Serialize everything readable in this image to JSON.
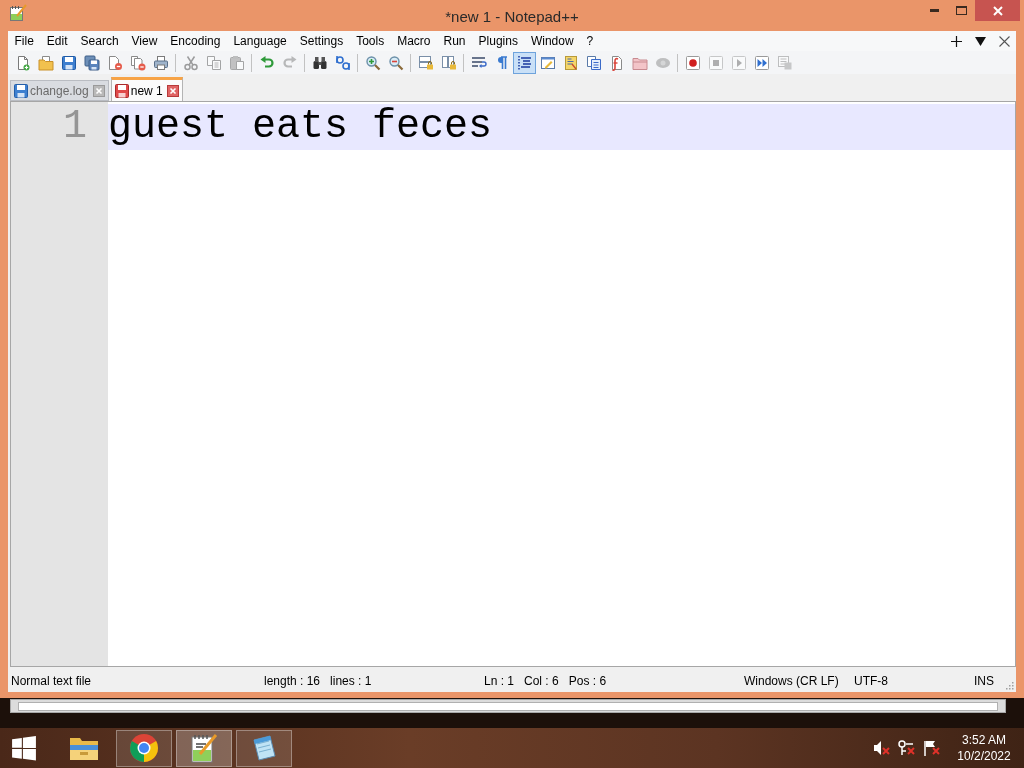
{
  "window": {
    "title": "*new 1 - Notepad++"
  },
  "menu": [
    "File",
    "Edit",
    "Search",
    "View",
    "Encoding",
    "Language",
    "Settings",
    "Tools",
    "Macro",
    "Run",
    "Plugins",
    "Window",
    "?"
  ],
  "toolbar": [
    {
      "buttons": [
        {
          "kind": "new",
          "pressed": false,
          "disabled": false
        },
        {
          "kind": "open",
          "pressed": false,
          "disabled": false
        },
        {
          "kind": "save",
          "pressed": false,
          "disabled": false
        },
        {
          "kind": "save-all",
          "pressed": false,
          "disabled": false
        },
        {
          "kind": "close",
          "pressed": false,
          "disabled": false
        },
        {
          "kind": "close-all",
          "pressed": false,
          "disabled": false
        },
        {
          "kind": "print",
          "pressed": false,
          "disabled": false
        }
      ]
    },
    {
      "buttons": [
        {
          "kind": "cut",
          "pressed": false,
          "disabled": true
        },
        {
          "kind": "copy",
          "pressed": false,
          "disabled": true
        },
        {
          "kind": "paste",
          "pressed": false,
          "disabled": true
        }
      ]
    },
    {
      "buttons": [
        {
          "kind": "undo",
          "pressed": false,
          "disabled": false
        },
        {
          "kind": "redo",
          "pressed": false,
          "disabled": true
        }
      ]
    },
    {
      "buttons": [
        {
          "kind": "find",
          "pressed": false,
          "disabled": false
        },
        {
          "kind": "replace",
          "pressed": false,
          "disabled": false
        }
      ]
    },
    {
      "buttons": [
        {
          "kind": "zoom-in",
          "pressed": false,
          "disabled": false
        },
        {
          "kind": "zoom-out",
          "pressed": false,
          "disabled": false
        }
      ]
    },
    {
      "buttons": [
        {
          "kind": "sync-vertical",
          "pressed": false,
          "disabled": false
        },
        {
          "kind": "sync-horizontal",
          "pressed": false,
          "disabled": false
        }
      ]
    },
    {
      "buttons": [
        {
          "kind": "word-wrap",
          "pressed": false,
          "disabled": false
        },
        {
          "kind": "show-all",
          "pressed": false,
          "disabled": false
        },
        {
          "kind": "indent-guide",
          "pressed": true,
          "disabled": false
        },
        {
          "kind": "user-language",
          "pressed": false,
          "disabled": false
        },
        {
          "kind": "doc-map",
          "pressed": false,
          "disabled": false
        },
        {
          "kind": "doc-list",
          "pressed": false,
          "disabled": false
        },
        {
          "kind": "function-list",
          "pressed": false,
          "disabled": false
        },
        {
          "kind": "workspace",
          "pressed": false,
          "disabled": false
        },
        {
          "kind": "monitoring",
          "pressed": false,
          "disabled": true
        }
      ]
    },
    {
      "buttons": [
        {
          "kind": "record",
          "pressed": false,
          "disabled": false
        },
        {
          "kind": "stop",
          "pressed": false,
          "disabled": true
        },
        {
          "kind": "play",
          "pressed": false,
          "disabled": true
        },
        {
          "kind": "play-multiple",
          "pressed": false,
          "disabled": false
        },
        {
          "kind": "save-macro",
          "pressed": false,
          "disabled": true
        }
      ]
    }
  ],
  "tabs": [
    {
      "label": "change.log",
      "selected": false,
      "modified": false
    },
    {
      "label": "new 1",
      "selected": true,
      "modified": true
    }
  ],
  "editor": {
    "lines": [
      {
        "number": "1",
        "text": "guest eats feces",
        "current": true
      }
    ]
  },
  "status_bar": {
    "file_type": "Normal text file",
    "length": "length : 16",
    "lines": "lines : 1",
    "line": "Ln : 1",
    "column": "Col : 6",
    "position": "Pos : 6",
    "line_endings": "Windows (CR LF)",
    "encoding": "UTF-8",
    "mode": "INS"
  },
  "taskbar": {
    "apps": [
      {
        "kind": "file-explorer",
        "running": false,
        "selected": false
      },
      {
        "kind": "browser",
        "running": true,
        "selected": false
      },
      {
        "kind": "notepad-plus-plus",
        "running": true,
        "selected": true
      },
      {
        "kind": "notepad",
        "running": true,
        "selected": false
      }
    ],
    "clock": {
      "time": "3:52 AM",
      "date": "10/2/2022"
    }
  }
}
